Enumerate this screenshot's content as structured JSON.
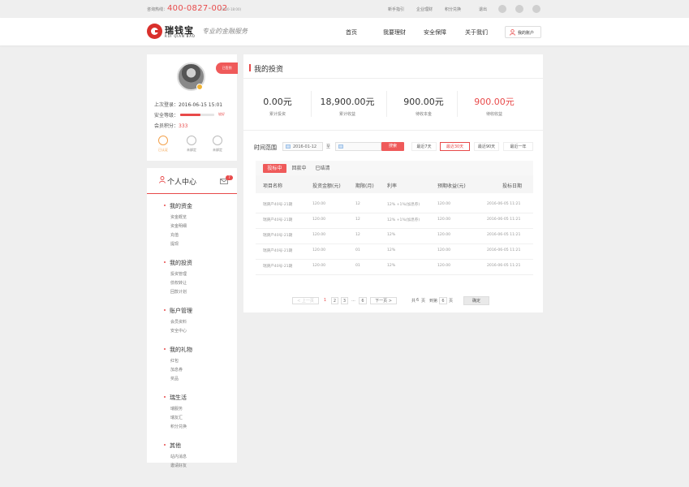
{
  "topbar": {
    "hotline_label": "咨询热线：",
    "hotline_number": "400-0827-002",
    "hotline_hours": "(9:00-18:00)",
    "links": [
      "新手指引",
      "企业理财",
      "积分兑换",
      "退出"
    ]
  },
  "header": {
    "logo_cn": "瑞钱宝",
    "logo_en": "RUI QIAN BAO",
    "slogan": "专业的金融服务",
    "nav": [
      "首页",
      "我要理财",
      "安全保障",
      "关于我们"
    ],
    "account_label": "我的账户"
  },
  "profile": {
    "checkin_label": "已签到",
    "last_login_label": "上次登录：",
    "last_login_value": "2016-06-15 15:01",
    "security_label": "安全等级：",
    "security_level_text": "较好",
    "security_level_fraction": 0.6,
    "points_label": "会员积分：",
    "points_value": "333",
    "badges": [
      {
        "label": "已认证",
        "active": true
      },
      {
        "label": "未绑定",
        "active": false
      },
      {
        "label": "未绑定",
        "active": false
      }
    ]
  },
  "sidebar": {
    "title": "个人中心",
    "mail_count": "7",
    "groups": [
      {
        "title": "我的资金",
        "items": [
          "资金概览",
          "资金明细",
          "充值",
          "提现"
        ]
      },
      {
        "title": "我的投资",
        "items": [
          "投资管理",
          "债权转让",
          "回款计划"
        ]
      },
      {
        "title": "账户管理",
        "items": [
          "会员资料",
          "安全中心"
        ]
      },
      {
        "title": "我的礼物",
        "items": [
          "红包",
          "加息券",
          "奖品"
        ]
      },
      {
        "title": "瑞生活",
        "items": [
          "瑞服务",
          "瑞友汇",
          "积分兑换"
        ]
      },
      {
        "title": "其他",
        "items": [
          "站内消息",
          "邀请好友"
        ]
      }
    ]
  },
  "main": {
    "title": "我的投资",
    "stats": [
      {
        "value": "0.00元",
        "label": "累计投资",
        "highlight": false
      },
      {
        "value": "18,900.00元",
        "label": "累计收益",
        "highlight": false
      },
      {
        "value": "900.00元",
        "label": "待收本金",
        "highlight": false
      },
      {
        "value": "900.00元",
        "label": "待收收益",
        "highlight": true
      }
    ],
    "filter": {
      "range_label": "时间范围",
      "start_date": "2016-01-12",
      "to_label": "至",
      "end_date": "",
      "search_label": "搜索",
      "quick_ranges": [
        "最近7天",
        "最近30天",
        "最近90天",
        "最近一年"
      ],
      "active_quick": 1
    },
    "tabs": [
      "投标中",
      "回款中",
      "已结清"
    ],
    "active_tab": 0,
    "table": {
      "headers": [
        "项目名称",
        "投资金额(元)",
        "期限(月)",
        "利率",
        "预期收益(元)",
        "投标日期"
      ],
      "rows": [
        [
          "瑞庚产40号-21期",
          "120.00",
          "12",
          "12% +1%(加息券)",
          "120.00",
          "2016-06-05 11:21"
        ],
        [
          "瑞庚产40号-21期",
          "120.00",
          "12",
          "12% +1%(加息券)",
          "120.00",
          "2016-06-05 11:21"
        ],
        [
          "瑞庚产40号-21期",
          "120.00",
          "12",
          "12%",
          "120.00",
          "2016-06-05 11:21"
        ],
        [
          "瑞庚产40号-21期",
          "120.00",
          "01",
          "12%",
          "120.00",
          "2016-06-05 11:21"
        ],
        [
          "瑞庚产40号-21期",
          "120.00",
          "01",
          "12%",
          "120.00",
          "2016-06-05 11:21"
        ]
      ]
    },
    "pagination": {
      "prev": "< 上一页",
      "pages": [
        "1",
        "2",
        "3",
        "...",
        "6"
      ],
      "current": "1",
      "next": "下一页 >",
      "total_prefix": "共",
      "total_pages": "6",
      "total_suffix": "页",
      "goto_prefix": "到第",
      "goto_value": "6",
      "goto_suffix": "页",
      "ok": "确定"
    }
  },
  "colors": {
    "accent": "#e84a4a",
    "badge_active": "#f3a24d"
  }
}
